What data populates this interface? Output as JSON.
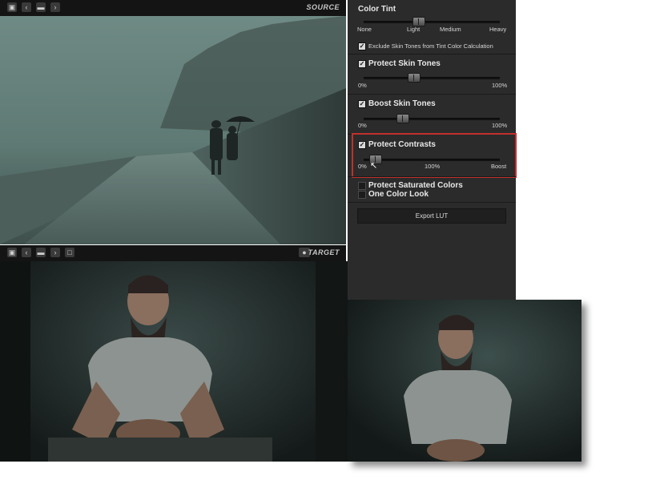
{
  "source_toolbar": {
    "label": "SOURCE",
    "icons": [
      "save-icon",
      "prev-icon",
      "folder-icon",
      "next-icon"
    ]
  },
  "target_toolbar": {
    "label": "TARGET",
    "icons": [
      "save-icon",
      "prev-icon",
      "folder-icon",
      "next-icon",
      "export-icon",
      "eye-icon"
    ]
  },
  "panel": {
    "color_tint": {
      "title": "Color Tint",
      "ticks": [
        "None",
        "Light",
        "Medium",
        "Heavy"
      ],
      "value_fraction": 0.3,
      "exclude_label": "Exclude Skin Tones from Tint Color Calculation",
      "exclude_checked": true
    },
    "protect_skin": {
      "title": "Protect Skin Tones",
      "checked": true,
      "min": "0%",
      "max": "100%",
      "value_fraction": 0.37
    },
    "boost_skin": {
      "title": "Boost Skin Tones",
      "checked": true,
      "min": "0%",
      "max": "100%",
      "value_fraction": 0.3
    },
    "protect_contrasts": {
      "title": "Protect Contrasts",
      "checked": true,
      "min": "0%",
      "mid": "100%",
      "max": "Boost",
      "value_fraction": 0.04
    },
    "protect_saturated": {
      "title": "Protect Saturated Colors",
      "checked": false
    },
    "one_color": {
      "title": "One Color Look",
      "checked": false
    },
    "export_label": "Export LUT"
  },
  "colors": {
    "highlight": "#c0302c",
    "panel_bg": "#2b2b2b",
    "toolbar_bg": "#141414"
  }
}
